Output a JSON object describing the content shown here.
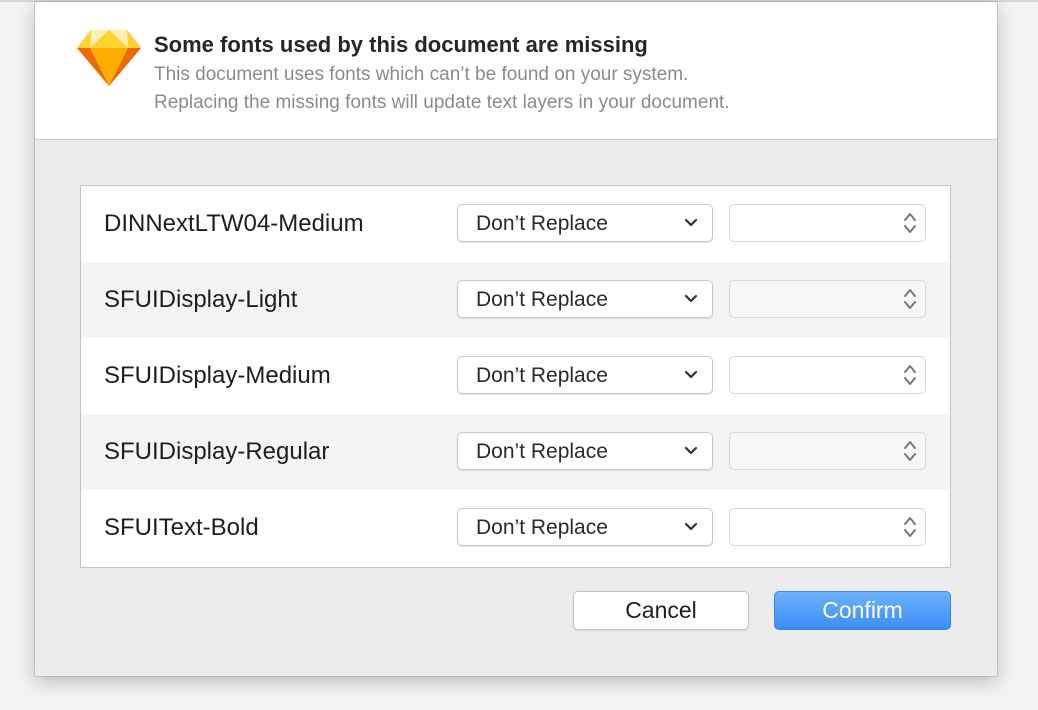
{
  "dialog": {
    "title": "Some fonts used by this document are missing",
    "message_line1": "This document uses fonts which can’t be found on your system.",
    "message_line2": "Replacing the missing fonts will update text layers in your document.",
    "app_icon": "sketch-diamond-icon"
  },
  "fonts": [
    {
      "name": "DINNextLTW04-Medium",
      "replacement": "Don’t Replace",
      "variant": ""
    },
    {
      "name": "SFUIDisplay-Light",
      "replacement": "Don’t Replace",
      "variant": ""
    },
    {
      "name": "SFUIDisplay-Medium",
      "replacement": "Don’t Replace",
      "variant": ""
    },
    {
      "name": "SFUIDisplay-Regular",
      "replacement": "Don’t Replace",
      "variant": ""
    },
    {
      "name": "SFUIText-Bold",
      "replacement": "Don’t Replace",
      "variant": ""
    }
  ],
  "buttons": {
    "cancel": "Cancel",
    "confirm": "Confirm"
  },
  "colors": {
    "accent": "#3c8cf5",
    "icon_orange": "#f7a81b"
  }
}
